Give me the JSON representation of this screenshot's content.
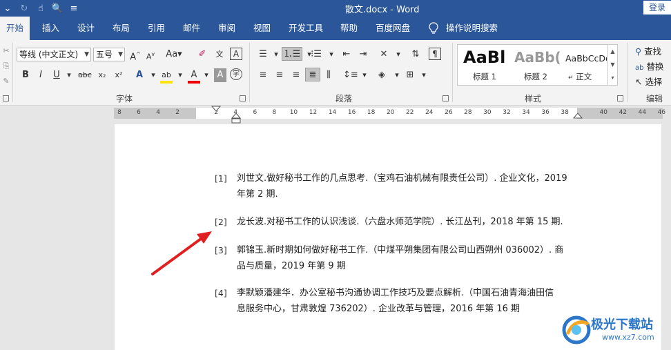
{
  "window": {
    "title": "散文.docx  -  Word",
    "login_label": "登录"
  },
  "tabs": [
    "开始",
    "插入",
    "设计",
    "布局",
    "引用",
    "邮件",
    "审阅",
    "视图",
    "开发工具",
    "帮助",
    "百度网盘",
    "操作说明搜索"
  ],
  "ribbon": {
    "font": {
      "font_name": "等线 (中文正文)",
      "font_size": "五号",
      "label": "字体"
    },
    "paragraph": {
      "label": "段落"
    },
    "styles": {
      "label": "样式",
      "items": [
        {
          "sample": "AaBl",
          "name": "标题 1"
        },
        {
          "sample": "AaBb(",
          "name": "标题 2"
        },
        {
          "sample": "AaBbCcDd",
          "name": "正文"
        }
      ]
    },
    "editing": {
      "label": "编辑",
      "find": "查找",
      "replace": "替换",
      "select": "选择"
    }
  },
  "ruler": {
    "ticks": [
      "8",
      "6",
      "4",
      "2",
      "",
      "2",
      "4",
      "6",
      "8",
      "10",
      "12",
      "14",
      "16",
      "18",
      "20",
      "22",
      "24",
      "26",
      "28",
      "30",
      "32",
      "34",
      "36",
      "38",
      "",
      "40",
      "42",
      "44",
      "46",
      "48"
    ]
  },
  "document": {
    "references": [
      {
        "num": "[1]",
        "lines": [
          "刘世文.做好秘书工作的几点思考.（宝鸡石油机械有限责任公司）. 企业文化，2019",
          "年第 2 期."
        ]
      },
      {
        "num": "[2]",
        "lines": [
          "龙长波.对秘书工作的认识浅谈.（六盘水师范学院）. 长江丛刊，2018 年第 15 期."
        ]
      },
      {
        "num": "[3]",
        "lines": [
          "郭锦玉.新时期如何做好秘书工作.（中煤平朔集团有限公司山西朔州 036002）. 商",
          "品与质量，2019 年第 9 期"
        ]
      },
      {
        "num": "[4]",
        "lines": [
          "李默颖潘建华．办公室秘书沟通协调工作技巧及要点解析.（中国石油青海油田信",
          "息服务中心，甘肃敦煌 736202）. 企业改革与管理，2016 年第 16 期"
        ]
      }
    ]
  },
  "watermark": {
    "name": "极光下载站",
    "url": "www.xz7.com"
  }
}
